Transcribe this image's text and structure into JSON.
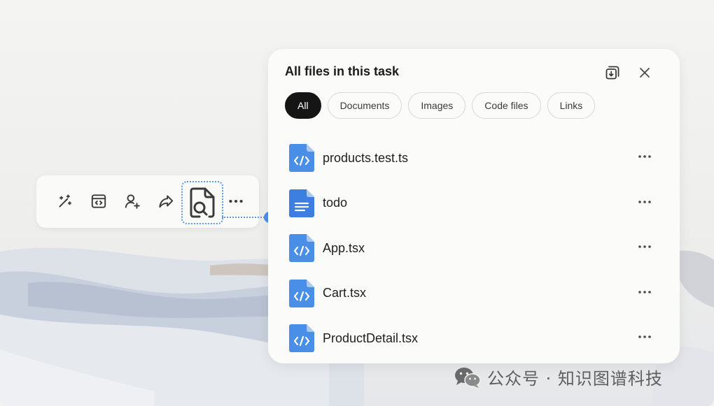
{
  "toolbar": {
    "buttons": [
      {
        "icon": "magic-wand-icon"
      },
      {
        "icon": "code-window-icon"
      },
      {
        "icon": "add-user-icon"
      },
      {
        "icon": "share-icon"
      },
      {
        "icon": "file-search-icon"
      },
      {
        "icon": "more-horizontal-icon"
      }
    ]
  },
  "panel": {
    "title": "All files in this task",
    "filters": [
      "All",
      "Documents",
      "Images",
      "Code files",
      "Links"
    ],
    "active_filter": "All",
    "files": [
      {
        "name": "products.test.ts",
        "type": "code"
      },
      {
        "name": "todo",
        "type": "document"
      },
      {
        "name": "App.tsx",
        "type": "code"
      },
      {
        "name": "Cart.tsx",
        "type": "code"
      },
      {
        "name": "ProductDetail.tsx",
        "type": "code"
      }
    ]
  },
  "watermark": {
    "text": "公众号 · 知识图谱科技"
  },
  "colors": {
    "accent": "#4a8fe7",
    "file_icon": "#4a8fe7",
    "active_chip": "#151515"
  }
}
